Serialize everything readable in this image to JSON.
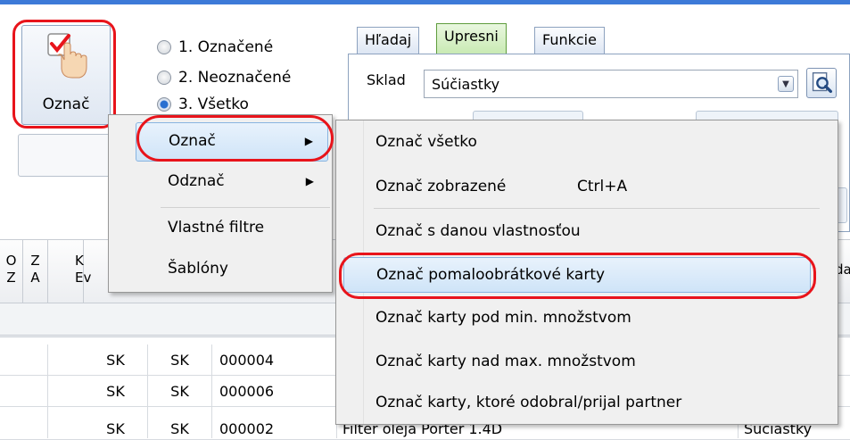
{
  "toolbar": {
    "mark_button_label": "Označ"
  },
  "radios": [
    {
      "label": "1. Označené",
      "selected": false
    },
    {
      "label": "2. Neoznačené",
      "selected": false
    },
    {
      "label": "3. Všetko",
      "selected": true
    }
  ],
  "tabs": [
    {
      "label": "Hľadaj",
      "active": false
    },
    {
      "label": "Upresni",
      "active": true
    },
    {
      "label": "Funkcie",
      "active": false
    }
  ],
  "panel": {
    "sklad_label": "Sklad",
    "sklad_value": "Súčiastky"
  },
  "grid": {
    "headers": [
      {
        "line1": "O",
        "line2": "Z"
      },
      {
        "line1": "Z",
        "line2": "A"
      },
      {
        "line1": "K",
        "line2": "Ev"
      },
      {
        "line1": "dad",
        "line2": ""
      }
    ],
    "rows": [
      {
        "a": "SK",
        "b": "SK",
        "code": "000004",
        "name": "",
        "sklad": ""
      },
      {
        "a": "SK",
        "b": "SK",
        "code": "000006",
        "name": "",
        "sklad": ""
      },
      {
        "a": "SK",
        "b": "SK",
        "code": "000002",
        "name": "Filter oleja Porter 1.4D",
        "sklad": "Súčiastky"
      }
    ]
  },
  "context_menu": {
    "items": [
      {
        "label": "Označ",
        "submenu": true
      },
      {
        "label": "Odznač",
        "submenu": true
      },
      {
        "label": "Vlastné filtre",
        "submenu": false
      },
      {
        "label": "Šablóny",
        "submenu": false
      }
    ]
  },
  "submenu": {
    "items": [
      {
        "label": "Označ všetko",
        "shortcut": ""
      },
      {
        "label": "Označ zobrazené",
        "shortcut": "Ctrl+A"
      },
      {
        "label": "Označ s danou vlastnosťou",
        "shortcut": ""
      },
      {
        "label": "Označ pomaloobrátkové karty",
        "shortcut": ""
      },
      {
        "label": "Označ karty pod min. množstvom",
        "shortcut": ""
      },
      {
        "label": "Označ karty nad max. množstvom",
        "shortcut": ""
      },
      {
        "label": "Označ karty, ktoré odobral/prijal partner",
        "shortcut": ""
      }
    ]
  },
  "colors": {
    "highlight_annotation": "#e8141b",
    "accent": "#3d7ad8"
  }
}
